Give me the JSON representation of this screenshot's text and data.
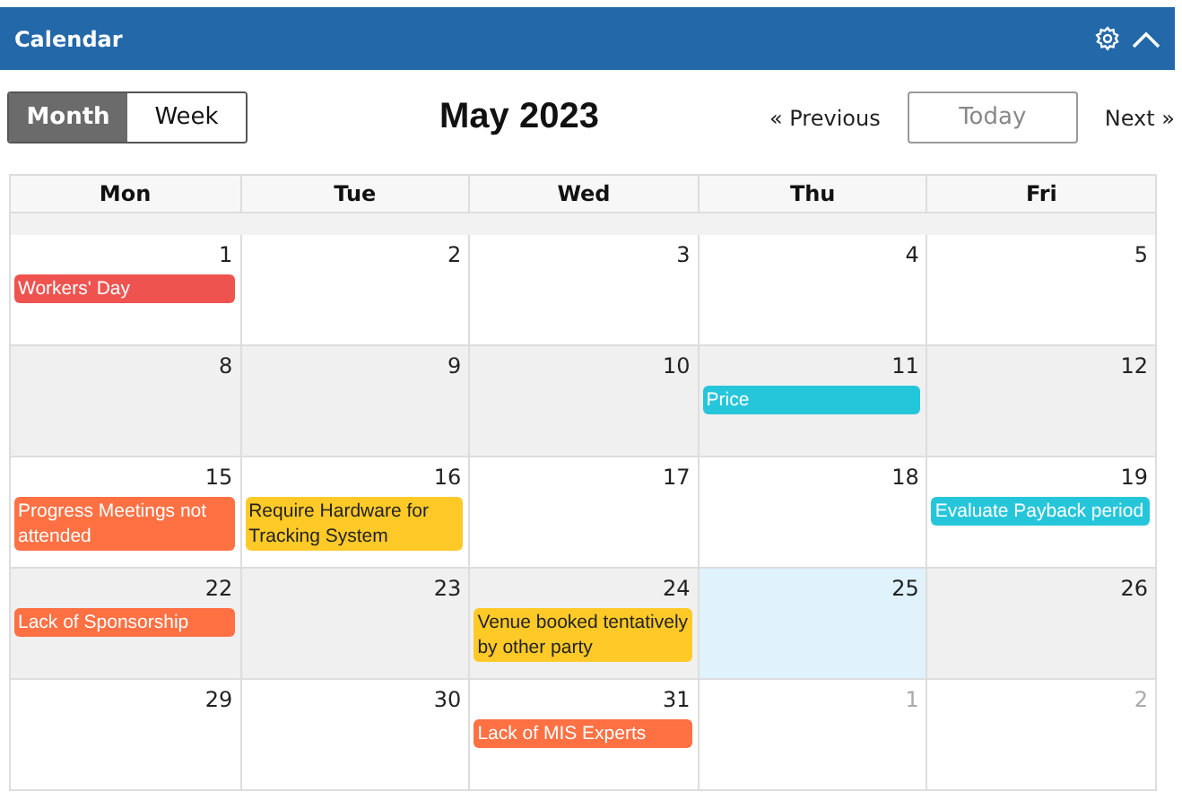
{
  "panel": {
    "title": "Calendar"
  },
  "view_tabs": [
    {
      "label": "Month",
      "selected": true
    },
    {
      "label": "Week",
      "selected": false
    }
  ],
  "month_title": "May 2023",
  "nav": {
    "previous": "« Previous",
    "today": "Today",
    "next": "Next »"
  },
  "columns": [
    "Mon",
    "Tue",
    "Wed",
    "Thu",
    "Fri"
  ],
  "weeks": [
    {
      "shaded": false,
      "days": [
        {
          "day": "1",
          "other_month": false,
          "today": false,
          "events": [
            {
              "title": "Workers' Day",
              "color": "#ef5350"
            }
          ]
        },
        {
          "day": "2",
          "other_month": false,
          "today": false
        },
        {
          "day": "3",
          "other_month": false,
          "today": false
        },
        {
          "day": "4",
          "other_month": false,
          "today": false
        },
        {
          "day": "5",
          "other_month": false,
          "today": false
        }
      ]
    },
    {
      "shaded": true,
      "days": [
        {
          "day": "8",
          "other_month": false,
          "today": false
        },
        {
          "day": "9",
          "other_month": false,
          "today": false
        },
        {
          "day": "10",
          "other_month": false,
          "today": false
        },
        {
          "day": "11",
          "other_month": false,
          "today": false,
          "events": [
            {
              "title": "Price",
              "color": "#26c6da"
            }
          ]
        },
        {
          "day": "12",
          "other_month": false,
          "today": false
        }
      ]
    },
    {
      "shaded": false,
      "days": [
        {
          "day": "15",
          "other_month": false,
          "today": false,
          "events": [
            {
              "title": "Progress Meetings not attended",
              "color": "#ff7043"
            }
          ]
        },
        {
          "day": "16",
          "other_month": false,
          "today": false,
          "events": [
            {
              "title": "Require Hardware for Tracking System",
              "color": "#ffca28"
            }
          ]
        },
        {
          "day": "17",
          "other_month": false,
          "today": false
        },
        {
          "day": "18",
          "other_month": false,
          "today": false
        },
        {
          "day": "19",
          "other_month": false,
          "today": false,
          "events": [
            {
              "title": "Evaluate Payback period",
              "color": "#26c6da"
            }
          ]
        }
      ]
    },
    {
      "shaded": true,
      "days": [
        {
          "day": "22",
          "other_month": false,
          "today": false,
          "events": [
            {
              "title": "Lack of Sponsorship",
              "color": "#ff7043"
            }
          ]
        },
        {
          "day": "23",
          "other_month": false,
          "today": false
        },
        {
          "day": "24",
          "other_month": false,
          "today": false,
          "events": [
            {
              "title": "Venue booked tentatively by other party",
              "color": "#ffca28"
            }
          ]
        },
        {
          "day": "25",
          "other_month": false,
          "today": true
        },
        {
          "day": "26",
          "other_month": false,
          "today": false
        }
      ]
    },
    {
      "shaded": false,
      "days": [
        {
          "day": "29",
          "other_month": false,
          "today": false
        },
        {
          "day": "30",
          "other_month": false,
          "today": false
        },
        {
          "day": "31",
          "other_month": false,
          "today": false,
          "events": [
            {
              "title": "Lack of MIS Experts",
              "color": "#ff7043"
            }
          ]
        },
        {
          "day": "1",
          "other_month": true,
          "today": false
        },
        {
          "day": "2",
          "other_month": true,
          "today": false
        }
      ]
    }
  ]
}
